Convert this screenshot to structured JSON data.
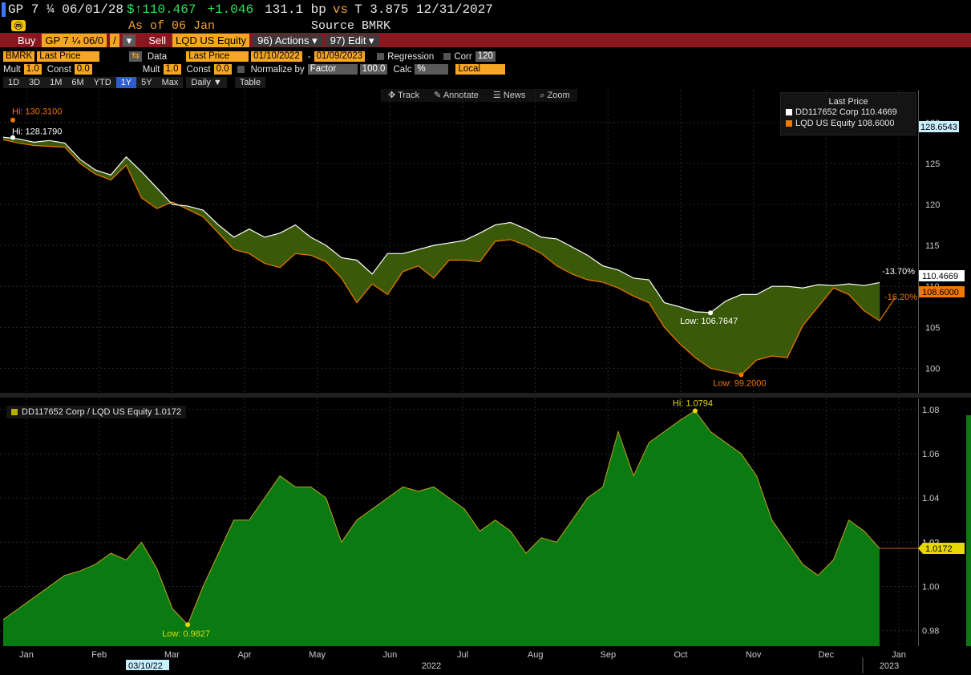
{
  "header": {
    "ticker": "GP 7 ¼ 06/01/28",
    "price": "$↑110.467",
    "change": "+1.046",
    "spread": "131.1 bp",
    "vs": "vs",
    "bench": "T 3.875 12/31/2027",
    "asof": "As of 06 Jan",
    "source": "Source BMRK"
  },
  "toolbar": {
    "buy": "Buy",
    "buy_sec": "GP 7 ¼ 06/0",
    "slash": "/",
    "sell": "Sell",
    "sell_sec": "LQD US Equity",
    "actions": "96) Actions ▾",
    "edit": "97) Edit ▾"
  },
  "settings": {
    "source": "BMRK",
    "field1": "Last Price",
    "data_label": "Data",
    "field2": "Last Price",
    "start": "01/10/2022",
    "dash": "-",
    "end": "01/09/2023",
    "regression": "Regression",
    "corr": "Corr",
    "corr_val": "120",
    "mult_label": "Mult",
    "mult1": "1.0",
    "const_label": "Const",
    "const1": "0.0",
    "mult2": "1.0",
    "const2": "0.0",
    "normalize": "Normalize by",
    "factor": "Factor",
    "factor_val": "100.0",
    "calc": "Calc",
    "calc_val": "%",
    "local": "Local"
  },
  "periods": [
    "1D",
    "3D",
    "1M",
    "6M",
    "YTD",
    "1Y",
    "5Y",
    "Max"
  ],
  "selected_period": "1Y",
  "frequency": "Daily ▼",
  "table_btn": "Table",
  "tools": [
    "Track",
    "Annotate",
    "News",
    "Zoom"
  ],
  "legend_top": {
    "title": "Last Price",
    "items": [
      {
        "label": "DD117652 Corp  110.4669",
        "color": "#ffffff"
      },
      {
        "label": "LQD US Equity  108.6000",
        "color": "#f07800"
      }
    ]
  },
  "legend_bottom": {
    "label": "DD117652 Corp / LQD US Equity 1.0172"
  },
  "colors": {
    "above": "#3a5a0a",
    "below": "#8a1010",
    "ratio_fill": "#0a7a12",
    "ratio_line": "#c8a020",
    "lqd": "#f07800"
  },
  "chart_data": [
    {
      "type": "line",
      "x_labels": [
        "Jan",
        "Feb",
        "Mar",
        "Apr",
        "May",
        "Jun",
        "Jul",
        "Aug",
        "Sep",
        "Oct",
        "Nov",
        "Dec",
        "Jan"
      ],
      "years": [
        "2022",
        "2023"
      ],
      "ylim": [
        97,
        134
      ],
      "yticks": [
        100,
        105,
        110,
        115,
        120,
        125,
        130
      ],
      "series": [
        {
          "name": "DD117652 Corp",
          "values": [
            128.2,
            128,
            127.6,
            127.8,
            127.5,
            125.5,
            124.2,
            123.6,
            125.8,
            124,
            122,
            120,
            119.8,
            119.3,
            117.5,
            116,
            117,
            116,
            116.5,
            117.5,
            116,
            115,
            113.5,
            113.2,
            111.5,
            114,
            114,
            114.5,
            115,
            115.3,
            115.6,
            116.5,
            117.5,
            117.8,
            117,
            116,
            115.8,
            114.8,
            113.8,
            112.5,
            112,
            111,
            110.8,
            108,
            107.5,
            106.9,
            106.8,
            108.2,
            109,
            109,
            110,
            110,
            109.8,
            110.2,
            110.1,
            110.3,
            110.1,
            110.4669
          ]
        },
        {
          "name": "LQD US Equity",
          "values": [
            127.9,
            127.5,
            127.2,
            127.1,
            127,
            125,
            123.7,
            123,
            124.8,
            120.8,
            119.5,
            120.3,
            119.4,
            118.5,
            116.5,
            114.5,
            114,
            112.8,
            112.3,
            114,
            113.8,
            113,
            111,
            108,
            110.3,
            109,
            111.8,
            112.5,
            111,
            113.2,
            113.2,
            113,
            115.5,
            115.7,
            115,
            114,
            112.5,
            111.5,
            110.8,
            110.5,
            109.8,
            108.8,
            108,
            105,
            103,
            101.3,
            100,
            99.6,
            99.2,
            101,
            101.5,
            101.3,
            105.2,
            107.5,
            109.8,
            109,
            107,
            105.8,
            108.6
          ]
        }
      ],
      "annotations": [
        {
          "text": "Hi: 130.3100",
          "value": 130.31
        },
        {
          "text": "Hi: 128.1790",
          "value": 128.179
        },
        {
          "text": "Low: 106.7647",
          "value": 106.7647
        },
        {
          "text": "Low: 99.2000",
          "value": 99.2
        }
      ],
      "right_labels": {
        "diff1": "-13.70%",
        "diff2": "-16.20%",
        "last1": "110.4669",
        "last2": "108.6000",
        "cursor": "128.6543"
      }
    },
    {
      "type": "area",
      "x_labels": [
        "Jan",
        "Feb",
        "Mar",
        "Apr",
        "May",
        "Jun",
        "Jul",
        "Aug",
        "Sep",
        "Oct",
        "Nov",
        "Dec",
        "Jan"
      ],
      "ylim": [
        0.973,
        1.085
      ],
      "yticks": [
        0.98,
        1.0,
        1.02,
        1.04,
        1.06,
        1.08
      ],
      "series": [
        {
          "name": "DD117652 Corp / LQD US Equity",
          "values": [
            0.985,
            0.99,
            0.995,
            1.0,
            1.005,
            1.007,
            1.01,
            1.015,
            1.012,
            1.02,
            1.008,
            0.99,
            0.9827,
            1.0,
            1.015,
            1.03,
            1.03,
            1.04,
            1.05,
            1.045,
            1.045,
            1.04,
            1.02,
            1.03,
            1.035,
            1.04,
            1.045,
            1.043,
            1.045,
            1.04,
            1.035,
            1.025,
            1.03,
            1.025,
            1.015,
            1.022,
            1.02,
            1.03,
            1.04,
            1.045,
            1.07,
            1.05,
            1.065,
            1.07,
            1.075,
            1.0794,
            1.07,
            1.065,
            1.06,
            1.05,
            1.03,
            1.02,
            1.01,
            1.005,
            1.012,
            1.03,
            1.025,
            1.0172
          ]
        }
      ],
      "annotations": [
        {
          "text": "Hi: 1.0794",
          "value": 1.0794
        },
        {
          "text": "Low: 0.9827",
          "value": 0.9827
        }
      ],
      "right_labels": {
        "last": "1.0172",
        "hidden_tick": "1.02"
      },
      "marker_date": "03/10/22"
    }
  ]
}
